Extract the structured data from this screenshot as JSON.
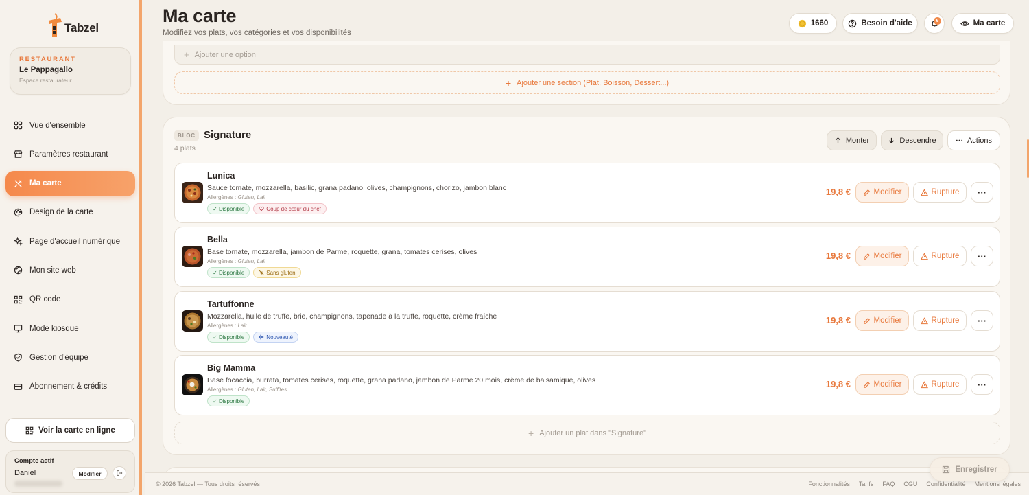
{
  "brand": {
    "name": "Tabzel",
    "tagline": ""
  },
  "restaurant": {
    "label": "RESTAURANT",
    "name": "Le Pappagallo",
    "sub": "Espace restaurateur"
  },
  "nav": [
    {
      "label": "Vue d'ensemble",
      "icon": "grid-icon"
    },
    {
      "label": "Paramètres restaurant",
      "icon": "store-icon"
    },
    {
      "label": "Ma carte",
      "icon": "utensils-icon",
      "active": true
    },
    {
      "label": "Design de la carte",
      "icon": "palette-icon"
    },
    {
      "label": "Page d'accueil numérique",
      "icon": "sparkle-icon"
    },
    {
      "label": "Mon site web",
      "icon": "globe-icon"
    },
    {
      "label": "QR code",
      "icon": "qr-icon"
    },
    {
      "label": "Mode kiosque",
      "icon": "monitor-icon"
    },
    {
      "label": "Gestion d'équipe",
      "icon": "shield-icon"
    },
    {
      "label": "Abonnement & crédits",
      "icon": "card-icon"
    }
  ],
  "sidebar": {
    "online_label": "Voir la carte en ligne"
  },
  "account": {
    "label": "Compte actif",
    "name": "Daniel",
    "edit_label": "Modifier"
  },
  "header": {
    "title": "Ma carte",
    "subtitle": "Modifiez vos plats, vos catégories et vos disponibilités",
    "credits": "1660",
    "help_label": "Besoin d'aide",
    "notif_count": "6",
    "view_label": "Ma carte"
  },
  "top_card": {
    "add_option": "Ajouter une option",
    "add_section": "Ajouter une section (Plat, Boisson, Dessert...)"
  },
  "block": {
    "tag": "BLOC",
    "title": "Signature",
    "count": "4 plats",
    "up_label": "Monter",
    "down_label": "Descendre",
    "actions_label": "Actions",
    "add_dish": "Ajouter un plat dans \"Signature\"",
    "dishes": [
      {
        "name": "Lunica",
        "description": "Sauce tomate, mozzarella, basilic, grana padano, olives, champignons, chorizo, jambon blanc",
        "allergens_label": "Allergènes :",
        "allergens": "Gluten, Lait",
        "tags": [
          {
            "label": "Disponible",
            "style": "green",
            "icon": "check"
          },
          {
            "label": "Coup de cœur du chef",
            "style": "pink",
            "icon": "heart"
          }
        ],
        "price": "19,8 €"
      },
      {
        "name": "Bella",
        "description": "Base tomate, mozzarella, jambon de Parme, roquette, grana, tomates cerises, olives",
        "allergens_label": "Allergènes :",
        "allergens": "Gluten, Lait",
        "tags": [
          {
            "label": "Disponible",
            "style": "green",
            "icon": "check"
          },
          {
            "label": "Sans gluten",
            "style": "yellow",
            "icon": "wheat"
          }
        ],
        "price": "19,8 €"
      },
      {
        "name": "Tartuffonne",
        "description": "Mozzarella, huile de truffe, brie, champignons, tapenade à la truffe, roquette, crème fraîche",
        "allergens_label": "Allergènes :",
        "allergens": "Lait",
        "tags": [
          {
            "label": "Disponible",
            "style": "green",
            "icon": "check"
          },
          {
            "label": "Nouveauté",
            "style": "blue",
            "icon": "sparkle"
          }
        ],
        "price": "19,8 €"
      },
      {
        "name": "Big Mamma",
        "description": "Base focaccia, burrata, tomates cerises, roquette, grana padano, jambon de Parme 20 mois, crème de balsamique, olives",
        "allergens_label": "Allergènes :",
        "allergens": "Gluten, Lait, Sulfites",
        "tags": [
          {
            "label": "Disponible",
            "style": "green",
            "icon": "check"
          }
        ],
        "price": "19,8 €"
      }
    ],
    "edit_label": "Modifier",
    "out_label": "Rupture"
  },
  "footer": {
    "copyright": "© 2026 Tabzel — Tous droits réservés",
    "links": [
      "Fonctionnalités",
      "Tarifs",
      "FAQ",
      "CGU",
      "Confidentialité",
      "Mentions légales"
    ],
    "save_label": "Enregistrer"
  },
  "colors": {
    "accent": "#e8793d",
    "accent_light": "#f5894c",
    "background": "#f3efe8"
  }
}
